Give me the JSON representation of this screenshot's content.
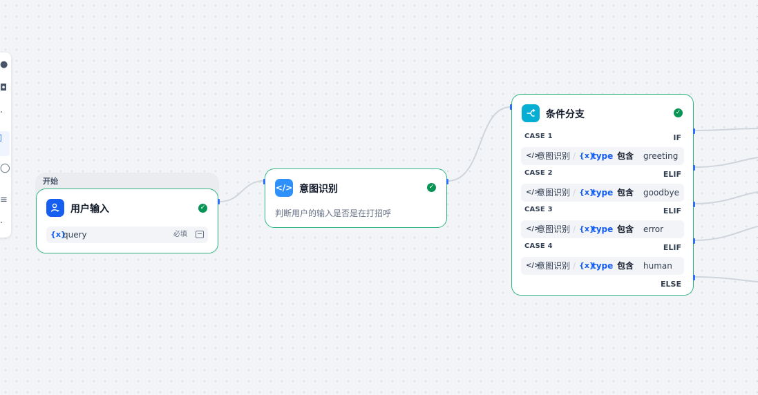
{
  "start": {
    "group_label": "开始",
    "title": "用户输入",
    "variable": {
      "symbol": "{x}",
      "name": "query",
      "required_label": "必填"
    }
  },
  "intent": {
    "title": "意图识别",
    "description": "判断用户的输入是否是在打招呼"
  },
  "branch": {
    "title": "条件分支",
    "cases": [
      {
        "label": "CASE 1",
        "keyword": "IF",
        "node": "意图识别",
        "symbol": "{x}",
        "variable": "type",
        "operator": "包含",
        "value": "greeting"
      },
      {
        "label": "CASE 2",
        "keyword": "ELIF",
        "node": "意图识别",
        "symbol": "{x}",
        "variable": "type",
        "operator": "包含",
        "value": "goodbye"
      },
      {
        "label": "CASE 3",
        "keyword": "ELIF",
        "node": "意图识别",
        "symbol": "{x}",
        "variable": "type",
        "operator": "包含",
        "value": "error"
      },
      {
        "label": "CASE 4",
        "keyword": "ELIF",
        "node": "意图识别",
        "symbol": "{x}",
        "variable": "type",
        "operator": "包含",
        "value": "human"
      }
    ],
    "else_label": "ELSE"
  },
  "icons": {
    "start": "user-input-icon",
    "intent": "code-icon",
    "branch": "branch-icon",
    "status": "check-circle-icon"
  },
  "colors": {
    "node_border": "#2fb680",
    "status_ok": "#079455",
    "accent": "#155eef",
    "start_icon_bg": "#155eef",
    "intent_icon_bg": "#2e90fa",
    "branch_icon_bg": "#06aed4",
    "edge": "#d0d5dd"
  }
}
